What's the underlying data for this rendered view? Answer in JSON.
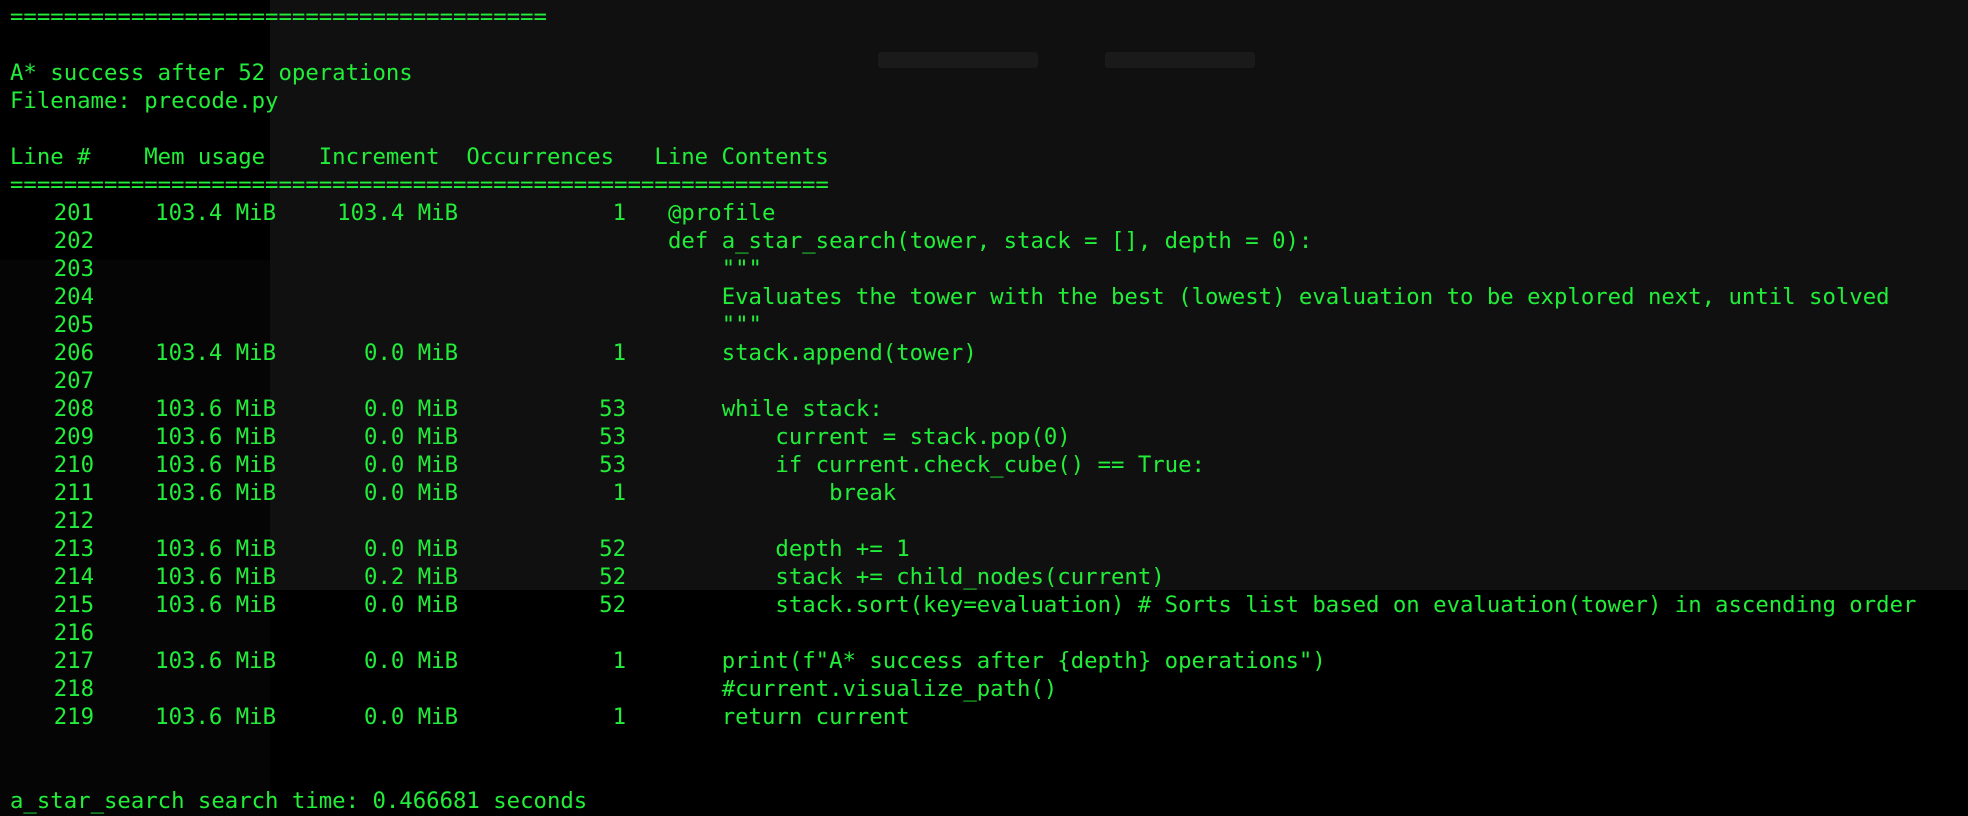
{
  "header": {
    "separator_top": "========================================",
    "status_message": "A* success after 52 operations",
    "filename_line": "Filename: precode.py",
    "column_headers": "Line #    Mem usage    Increment  Occurrences   Line Contents",
    "separator_table": "============================================================="
  },
  "table": {
    "rows": [
      {
        "line": "201",
        "mem": "103.4 MiB",
        "inc": "103.4 MiB",
        "occ": "1",
        "code": "@profile"
      },
      {
        "line": "202",
        "mem": "",
        "inc": "",
        "occ": "",
        "code": "def a_star_search(tower, stack = [], depth = 0):"
      },
      {
        "line": "203",
        "mem": "",
        "inc": "",
        "occ": "",
        "code": "    \"\"\""
      },
      {
        "line": "204",
        "mem": "",
        "inc": "",
        "occ": "",
        "code": "    Evaluates the tower with the best (lowest) evaluation to be explored next, until solved"
      },
      {
        "line": "205",
        "mem": "",
        "inc": "",
        "occ": "",
        "code": "    \"\"\""
      },
      {
        "line": "206",
        "mem": "103.4 MiB",
        "inc": "0.0 MiB",
        "occ": "1",
        "code": "    stack.append(tower)"
      },
      {
        "line": "207",
        "mem": "",
        "inc": "",
        "occ": "",
        "code": ""
      },
      {
        "line": "208",
        "mem": "103.6 MiB",
        "inc": "0.0 MiB",
        "occ": "53",
        "code": "    while stack:"
      },
      {
        "line": "209",
        "mem": "103.6 MiB",
        "inc": "0.0 MiB",
        "occ": "53",
        "code": "        current = stack.pop(0)"
      },
      {
        "line": "210",
        "mem": "103.6 MiB",
        "inc": "0.0 MiB",
        "occ": "53",
        "code": "        if current.check_cube() == True:"
      },
      {
        "line": "211",
        "mem": "103.6 MiB",
        "inc": "0.0 MiB",
        "occ": "1",
        "code": "            break"
      },
      {
        "line": "212",
        "mem": "",
        "inc": "",
        "occ": "",
        "code": ""
      },
      {
        "line": "213",
        "mem": "103.6 MiB",
        "inc": "0.0 MiB",
        "occ": "52",
        "code": "        depth += 1"
      },
      {
        "line": "214",
        "mem": "103.6 MiB",
        "inc": "0.2 MiB",
        "occ": "52",
        "code": "        stack += child_nodes(current)"
      },
      {
        "line": "215",
        "mem": "103.6 MiB",
        "inc": "0.0 MiB",
        "occ": "52",
        "code": "        stack.sort(key=evaluation) # Sorts list based on evaluation(tower) in ascending order"
      },
      {
        "line": "216",
        "mem": "",
        "inc": "",
        "occ": "",
        "code": ""
      },
      {
        "line": "217",
        "mem": "103.6 MiB",
        "inc": "0.0 MiB",
        "occ": "1",
        "code": "    print(f\"A* success after {depth} operations\")"
      },
      {
        "line": "218",
        "mem": "",
        "inc": "",
        "occ": "",
        "code": "    #current.visualize_path()"
      },
      {
        "line": "219",
        "mem": "103.6 MiB",
        "inc": "0.0 MiB",
        "occ": "1",
        "code": "    return current"
      }
    ]
  },
  "footer": {
    "timing": "a_star_search search time: 0.466681 seconds"
  },
  "colors": {
    "text": "#22ee3a",
    "background": "#000000"
  }
}
